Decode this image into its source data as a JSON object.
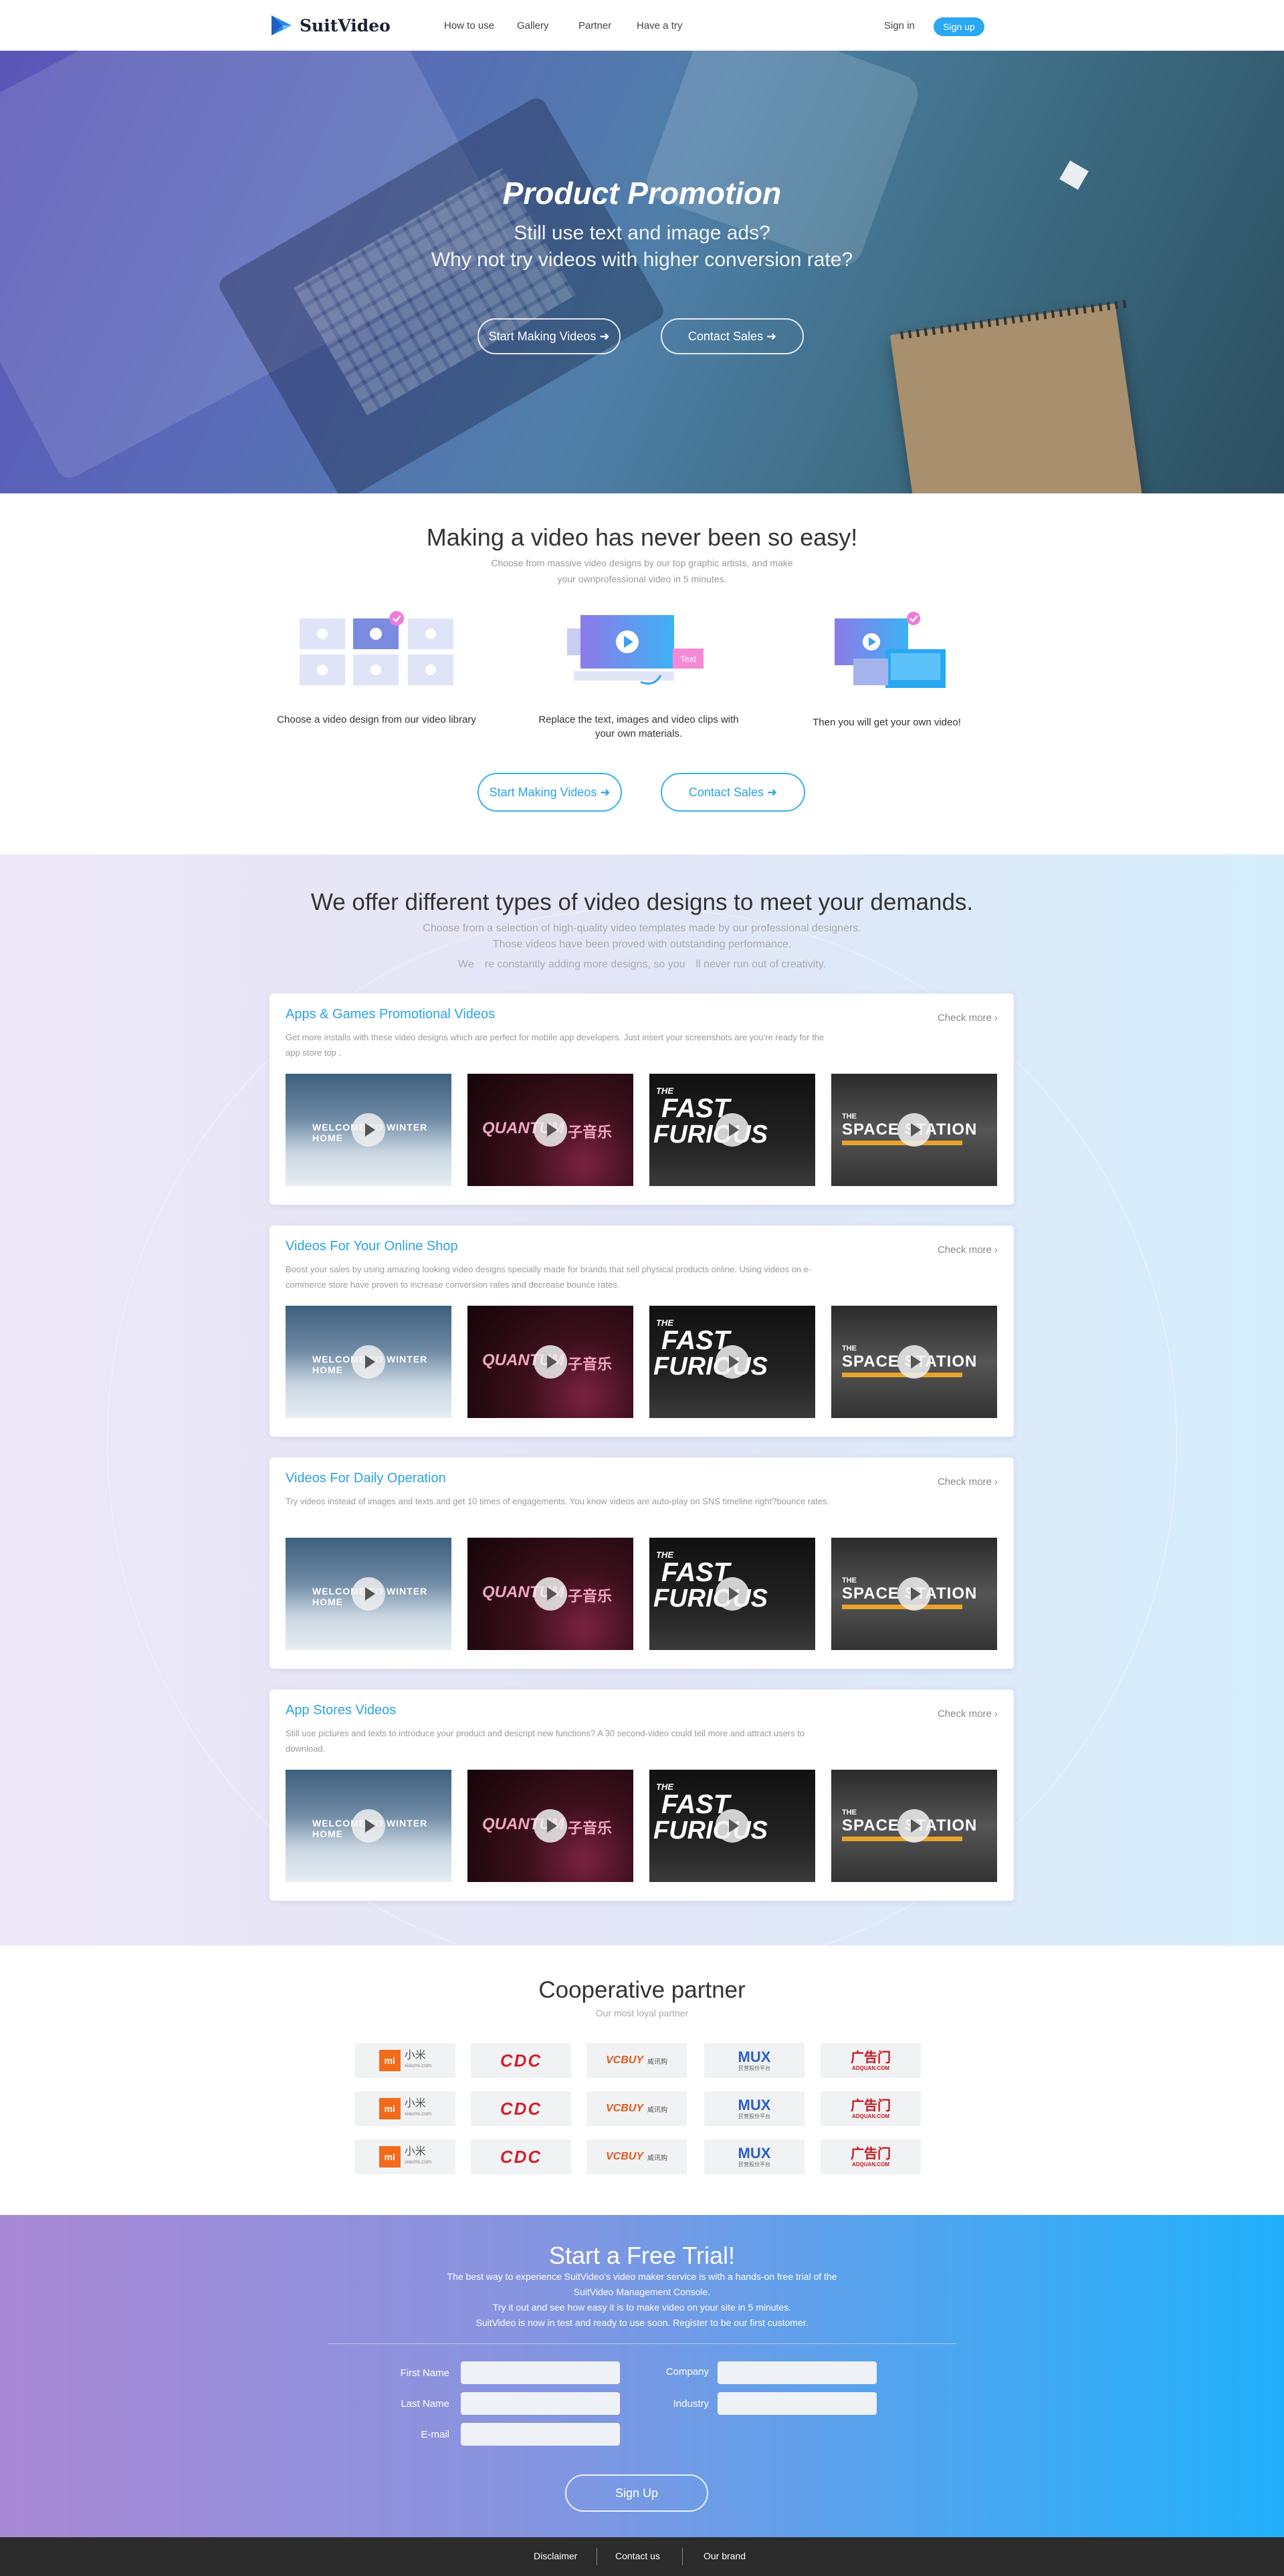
{
  "header": {
    "brand": "SuitVideo",
    "nav": [
      "How to use",
      "Gallery",
      "Partner",
      "Have a try"
    ],
    "sign_in": "Sign in",
    "sign_up": "Sign up"
  },
  "hero": {
    "title": "Product Promotion",
    "line1": "Still use text and image ads?",
    "line2": "Why not try videos with higher conversion rate?",
    "start_button": "Start Making Videos",
    "contact_button": "Contact Sales"
  },
  "easy": {
    "title": "Making a video has never been so easy!",
    "subtitle_1": "Choose from massive video designs by our top graphic artists, and make",
    "subtitle_2": "your ownprofessional video in 5 minutes.",
    "steps": [
      "Choose a video design from our video library",
      "Replace the text, images and video clips with your own materials.",
      "Then you will get your own video!"
    ],
    "text_tag": "Text",
    "start_button": "Start Making Videos",
    "contact_button": "Contact Sales"
  },
  "designs": {
    "title": "We offer different types of video designs to meet your demands.",
    "sub_1": "Choose from a selection of high-quality video templates made by our professional designers.",
    "sub_2": "Those videos have been proved with outstanding performance.",
    "sub_3": "We　re constantly adding more designs, so you　ll never run out of creativity.",
    "check_more": "Check more",
    "categories": [
      {
        "title": "Apps & Games Promotional Videos",
        "desc": "Get more installs with these video designs which are perfect for mobile app developers. Just insert your screenshots are you're ready for the app store top ."
      },
      {
        "title": "Videos For Your Online Shop",
        "desc": "Boost your sales by using amazing looking video designs specially made for brands that sell physical products online. Using videos on e-commerce store have proven to increase conversion rates and decrease bounce rates."
      },
      {
        "title": "Videos For Daily Operation",
        "desc": "Try videos instead of images and texts and get 10 times of engagements. You know videos are auto-play on SNS timeline right?bounce rates."
      },
      {
        "title": "App Stores Videos",
        "desc": "Still use pictures and texts to introduce your product and descript new functions? A 30 second-video could tell more and attract users to download."
      }
    ],
    "thumbs": {
      "t1": "WELCOME TO WINTER HOME",
      "t2": "QUANTUM",
      "t2b": "子音乐",
      "t3a": "THE",
      "t3b": "FAST",
      "t3c": "FURIOUS",
      "t4a": "THE",
      "t4b": "SPACE STATION"
    }
  },
  "partners": {
    "title": "Cooperative partner",
    "subtitle": "Our most loyal partner",
    "logos": {
      "mi": "小米",
      "mi_sub": "xiaomi.com",
      "mi_mark": "mi",
      "cdc": "CDC",
      "vcbuy": "VCBUY",
      "vcbuy_sub": "威讯购",
      "mux": "MUX",
      "mux_sub": "民营股份平台",
      "adquan": "广告门",
      "adquan_sub": "ADQUAN.COM"
    }
  },
  "trial": {
    "title": "Start a Free Trial!",
    "line1": "The best way to experience SuitVideo's video maker service is with a hands-on free trial of the",
    "line2": "SuitVideo Management Console.",
    "line3": "Try it out and see how easy it is to make video on your site in 5 minutes.",
    "line4": "SuitVideo is now in test and ready to use soon. Register to be our first customer.",
    "fields": {
      "first_name": "First Name",
      "last_name": "Last Name",
      "email": "E-mail",
      "company": "Company",
      "industry": "Industry"
    },
    "signup_button": "Sign Up"
  },
  "footer": {
    "links": [
      "Disclaimer",
      "Contact us",
      "Our brand"
    ]
  },
  "colors": {
    "accent": "#2aa8f2",
    "card_title": "#2aa3e6",
    "footer_bg": "#2b2b2b"
  }
}
